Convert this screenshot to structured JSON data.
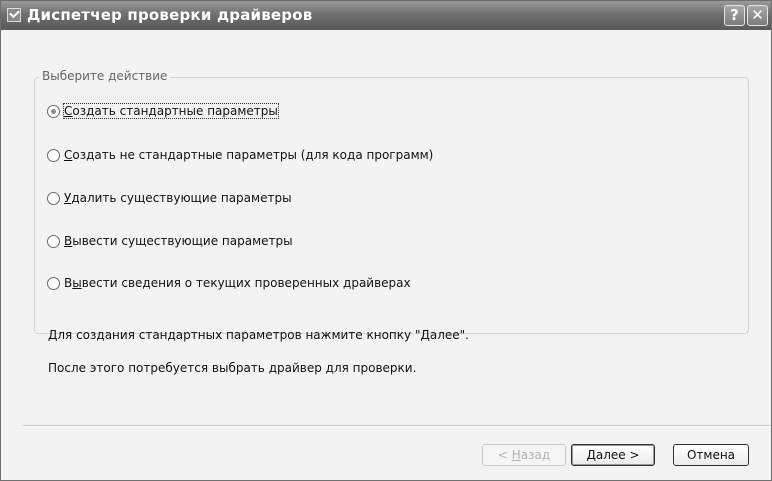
{
  "window": {
    "title": "Диспетчер проверки драйверов",
    "title_icon": "checkbox-icon",
    "help_glyph": "?",
    "close_glyph": "✕"
  },
  "group": {
    "legend": "Выберите действие"
  },
  "options": [
    {
      "pre": "",
      "hotkey": "С",
      "post": "оздать стандартные параметры",
      "checked": true
    },
    {
      "pre": "",
      "hotkey": "С",
      "post": "оздать не стандартные параметры (для кода программ)",
      "checked": false
    },
    {
      "pre": "",
      "hotkey": "У",
      "post": "далить существующие параметры",
      "checked": false
    },
    {
      "pre": "",
      "hotkey": "В",
      "post": "ывести существующие параметры",
      "checked": false
    },
    {
      "pre": "В",
      "hotkey": "ы",
      "post": "вести сведения о текущих проверенных драйверах",
      "checked": false
    }
  ],
  "info": {
    "line1": "Для создания стандартных параметров нажмите кнопку \"Далее\".",
    "line2": "После этого потребуется выбрать драйвер для проверки."
  },
  "buttons": {
    "back": {
      "pre": "< ",
      "hotkey": "Н",
      "post": "азад",
      "enabled": false
    },
    "next": {
      "pre": "",
      "hotkey": "Д",
      "post": "алее >",
      "enabled": true
    },
    "cancel": {
      "label": "Отмена",
      "enabled": true
    }
  },
  "colors": {
    "titlebar": "#6f6f6f",
    "dialog_bg": "#f3f3f3"
  }
}
